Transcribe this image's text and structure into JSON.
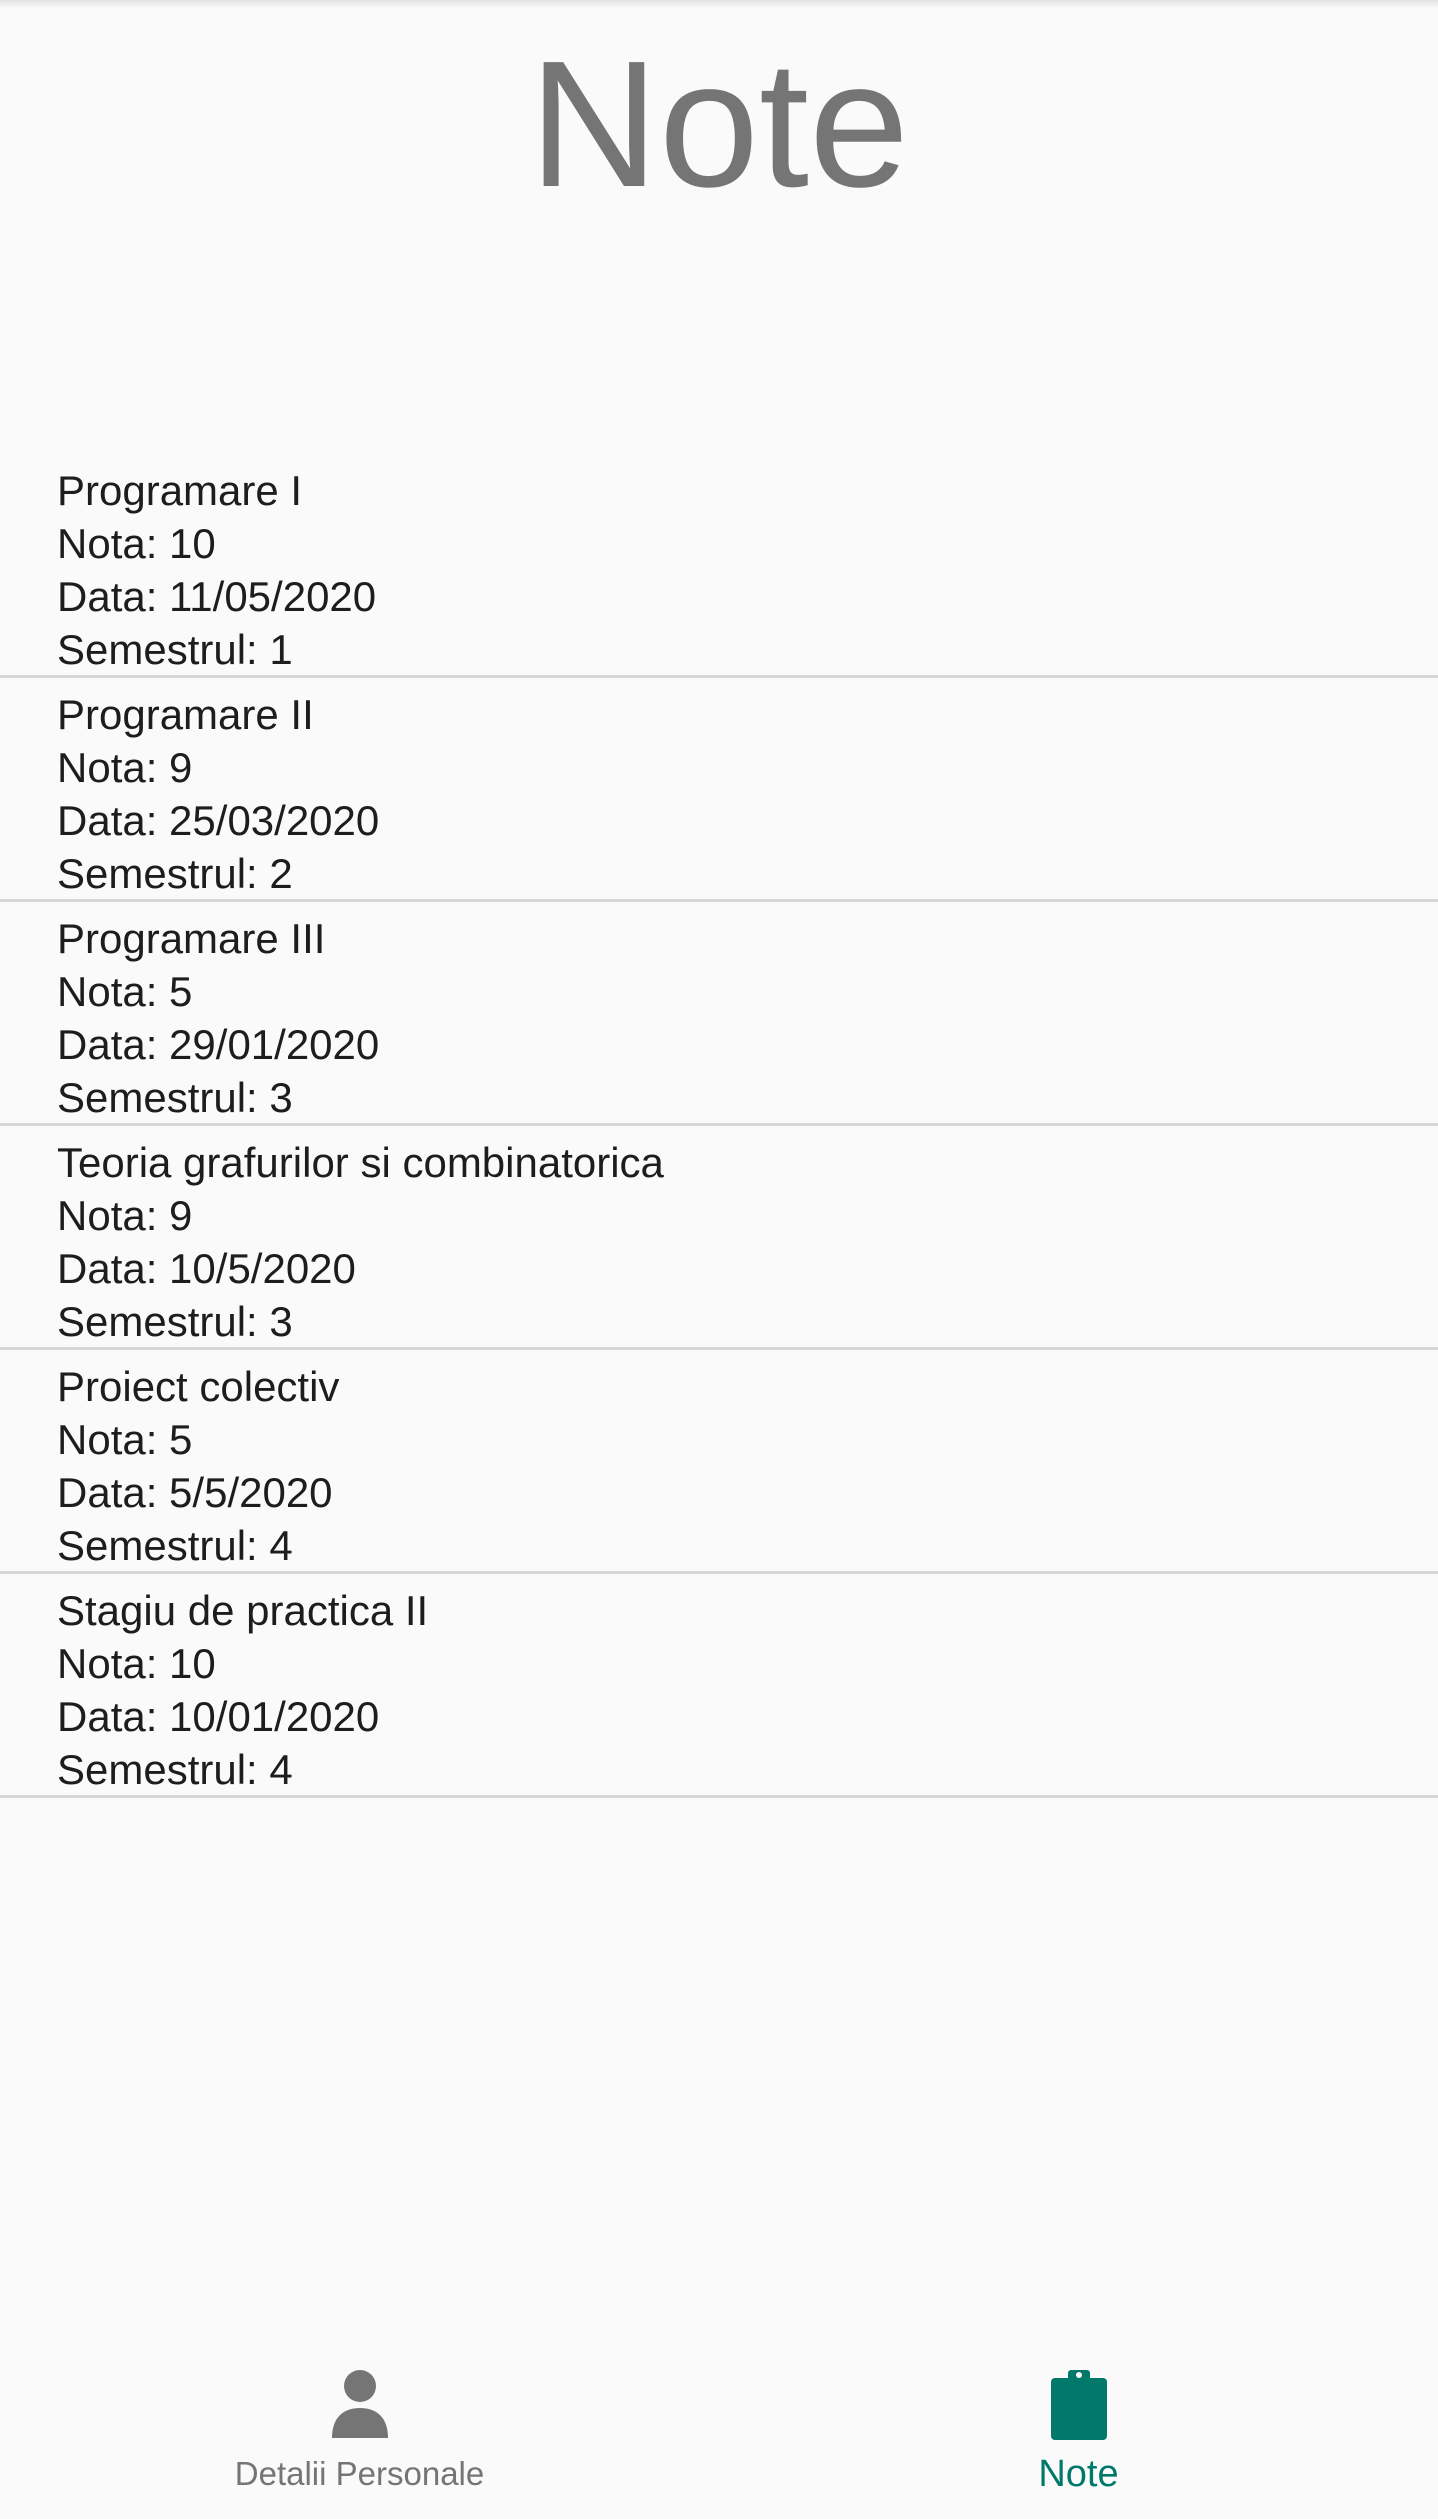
{
  "header": {
    "title": "Note"
  },
  "grades": [
    {
      "course": "Programare I",
      "nota": "Nota: 10",
      "data": "Data: 11/05/2020",
      "semestru": "Semestrul: 1"
    },
    {
      "course": "Programare II",
      "nota": "Nota: 9",
      "data": "Data: 25/03/2020",
      "semestru": "Semestrul: 2"
    },
    {
      "course": "Programare III",
      "nota": "Nota: 5",
      "data": "Data: 29/01/2020",
      "semestru": "Semestrul: 3"
    },
    {
      "course": "Teoria grafurilor si combinatorica",
      "nota": "Nota: 9",
      "data": "Data: 10/5/2020",
      "semestru": "Semestrul: 3"
    },
    {
      "course": "Proiect colectiv",
      "nota": "Nota: 5",
      "data": "Data: 5/5/2020",
      "semestru": "Semestrul: 4"
    },
    {
      "course": "Stagiu de practica II",
      "nota": "Nota: 10",
      "data": "Data: 10/01/2020",
      "semestru": "Semestrul: 4"
    }
  ],
  "bottom_nav": {
    "items": [
      {
        "label": "Detalii Personale",
        "icon": "person-icon",
        "active": false
      },
      {
        "label": "Note",
        "icon": "clipboard-icon",
        "active": true
      }
    ],
    "colors": {
      "active": "#00796b",
      "inactive": "#757575"
    }
  }
}
